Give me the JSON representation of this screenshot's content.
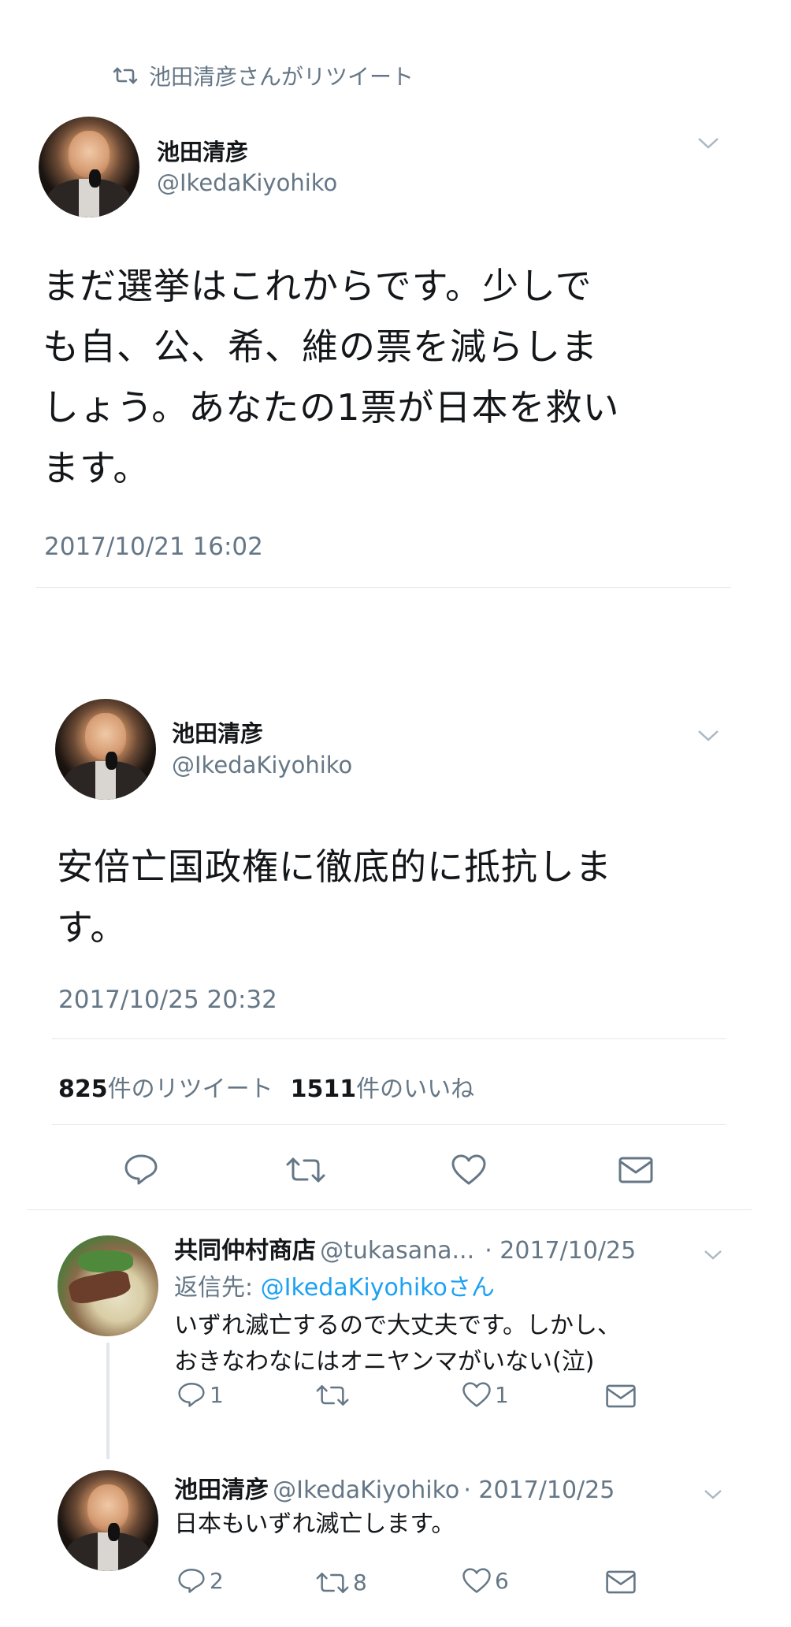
{
  "retweet_banner": {
    "text": "池田清彦さんがリツイート",
    "icon": "retweet-icon"
  },
  "tweet1": {
    "author_name": "池田清彦",
    "author_handle": "@IkedaKiyohiko",
    "text_lines": [
      "まだ選挙はこれからです。少しで",
      "も自、公、希、維の票を減らしま",
      "しょう。あなたの1票が日本を救い",
      "ます。"
    ],
    "timestamp": "2017/10/21 16:02"
  },
  "tweet2": {
    "author_name": "池田清彦",
    "author_handle": "@IkedaKiyohiko",
    "text_lines": [
      "安倍亡国政権に徹底的に抵抗しま",
      "す。"
    ],
    "timestamp": "2017/10/25 20:32",
    "stats": {
      "retweets": "825",
      "retweets_label": "件のリツイート",
      "likes": "1511",
      "likes_label": "件のいいね"
    }
  },
  "reply1": {
    "author_name": "共同仲村商店",
    "author_handle": "@tukasana...",
    "date": "· 2017/10/25",
    "reply_to_prefix": "返信先: ",
    "reply_to_handle": "@IkedaKiyohiko",
    "reply_to_suffix": "さん",
    "text_lines": [
      "いずれ滅亡するので大丈夫です。しかし、",
      "おきなわなにはオニヤンマがいない(泣)"
    ],
    "reply_count": "1",
    "retweet_count": "",
    "like_count": "1"
  },
  "reply2": {
    "author_name": "池田清彦",
    "author_handle": "@IkedaKiyohiko",
    "date": "· 2017/10/25",
    "text": "日本もいずれ滅亡します。",
    "reply_count": "2",
    "retweet_count": "8",
    "like_count": "6"
  },
  "colors": {
    "text": "#14171a",
    "secondary": "#657786",
    "link": "#1da1f2",
    "divider": "#e1e8ed"
  }
}
